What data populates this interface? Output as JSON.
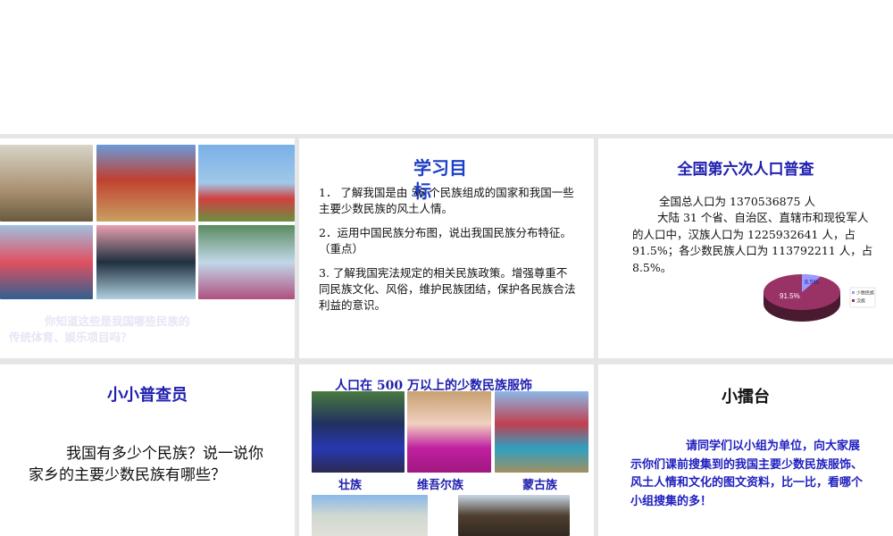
{
  "slides": [
    {
      "question": "你知道这些是我国哪些民族的传统体育、娱乐项目吗？",
      "photos": [
        "horse-racing-photo",
        "wrestling-photo",
        "pole-climbing-photo",
        "dragon-boat-photo",
        "boat-rowing-photo",
        "water-splashing-photo"
      ]
    },
    {
      "title": "学习目标",
      "items": [
        "1． 了解我国是由 56 个民族组成的国家和我国一些主要少数民族的风土人情。",
        "2．运用中国民族分布图，说出我国民族分布特征。（重点）",
        "3.  了解我国宪法规定的相关民族政策。增强尊重不同民族文化、风俗，维护民族团结，保护各民族合法利益的意识。"
      ]
    },
    {
      "title": "全国第六次人口普查",
      "line1": "全国总人口为 1370536875 人",
      "line2": "大陆 31 个省、自治区、直辖市和现役军人的人口中，汉族人口为 1225932641 人，占 91.5%；各少数民族人口为 113792211 人，占 8.5%。"
    },
    {
      "title": "小小普查员",
      "body": "我国有多少个民族？说一说你家乡的主要少数民族有哪些？"
    },
    {
      "title": "人口在 500 万以上的少数民族服饰",
      "captions": [
        "壮族",
        "维吾尔族",
        "蒙古族"
      ]
    },
    {
      "title": "小擂台",
      "body": "请同学们以小组为单位，向大家展示你们课前搜集到的我国主要少数民族服饰、风土人情和文化的图文资料，比一比，看哪个小组搜集的多！"
    }
  ],
  "chart_data": {
    "type": "pie",
    "categories": [
      "少数民族",
      "汉族"
    ],
    "values": [
      8.5,
      91.5
    ],
    "labels": [
      "8.5%",
      "91.5%"
    ],
    "colors": [
      "#9999ff",
      "#993366"
    ],
    "legend": "right"
  }
}
